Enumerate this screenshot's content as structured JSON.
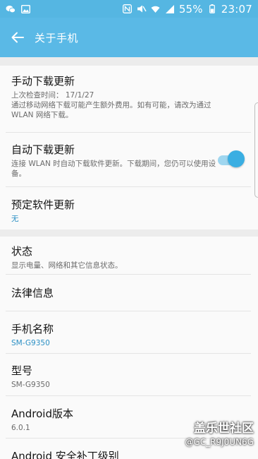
{
  "status_bar": {
    "battery": "55%",
    "time": "23:07",
    "background": "#55b6e2"
  },
  "app_bar": {
    "title": "关于手机",
    "back_icon": "arrow-left-icon",
    "background": "#5ab9e6"
  },
  "updates": {
    "manual": {
      "title": "手动下载更新",
      "last_check": "上次检查时间： 17/1/27",
      "description": "通过移动网络下载可能产生额外费用。如有可能，请改为通过 WLAN 网络下载。"
    },
    "auto": {
      "title": "自动下载更新",
      "description": "连接 WLAN 时自动下载软件更新。下载期间，您仍可以使用设备。",
      "enabled": true
    },
    "scheduled": {
      "title": "预定软件更新",
      "value": "无"
    }
  },
  "info": {
    "status": {
      "title": "状态",
      "description": "显示电量、网络和其它信息状态。"
    },
    "legal": {
      "title": "法律信息"
    },
    "device_name": {
      "title": "手机名称",
      "value": "SM-G9350"
    },
    "model": {
      "title": "型号",
      "value": "SM-G9350"
    },
    "android_version": {
      "title": "Android版本",
      "value": "6.0.1"
    },
    "security_patch": {
      "title": "Android 安全补丁级别"
    }
  },
  "watermark": {
    "line1": "盖乐世社区",
    "line2": "@GC_R9J0UN6G"
  },
  "accent_color": "#2a8fc4"
}
